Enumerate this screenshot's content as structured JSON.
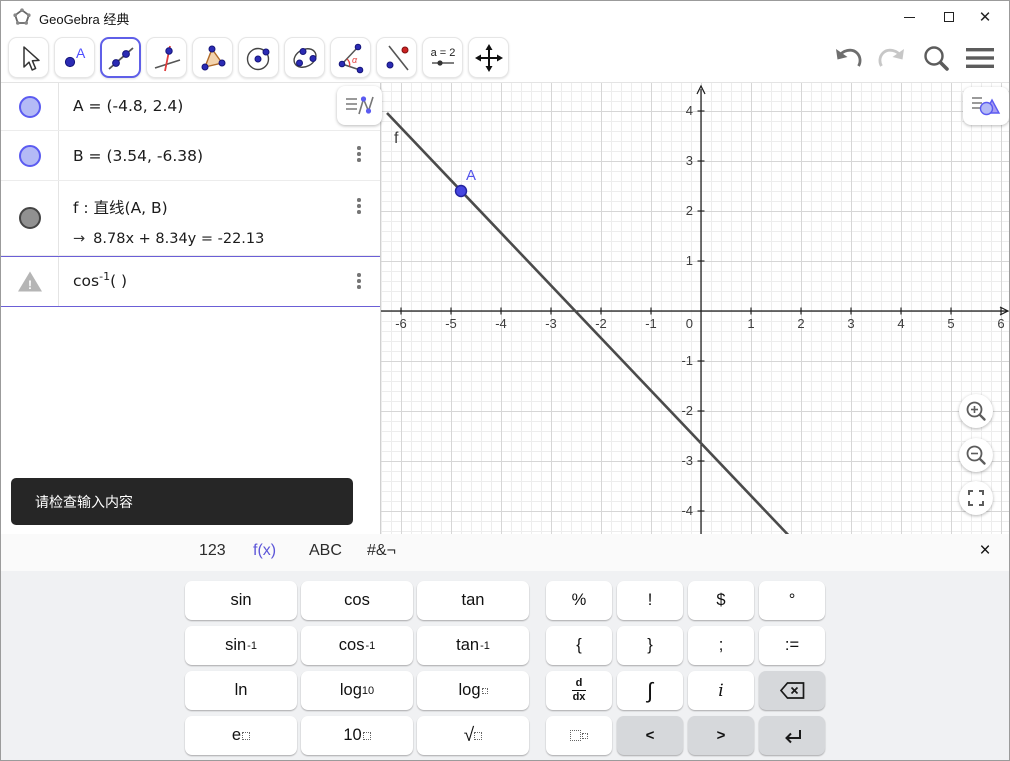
{
  "titlebar": {
    "title": "GeoGebra 经典"
  },
  "colors": {
    "accent": "#5b5bf1",
    "selected_tool_border": "#5f5fe8",
    "point": "#4646e0",
    "tooltip_bg": "#262626",
    "key_gray": "#d6d8db"
  },
  "toolbar": {
    "tools": [
      {
        "name": "move"
      },
      {
        "name": "point"
      },
      {
        "name": "line-through-two-points",
        "selected": true
      },
      {
        "name": "perpendicular-line"
      },
      {
        "name": "polygon"
      },
      {
        "name": "circle-with-center"
      },
      {
        "name": "conic-through-points"
      },
      {
        "name": "angle"
      },
      {
        "name": "reflect-about-line"
      },
      {
        "name": "slider"
      },
      {
        "name": "move-graphics-view"
      }
    ],
    "point_letter": "A",
    "angle_symbol": "α",
    "slider_label": "a = 2"
  },
  "algebra": {
    "rows": [
      {
        "id": "A",
        "text": "A = (-4.8, 2.4)"
      },
      {
        "id": "B",
        "text": "B = (3.54, -6.38)"
      },
      {
        "id": "f",
        "line1": "f : 直线(A, B)",
        "arrow": "→",
        "line2": "8.78x + 8.34y = -22.13"
      },
      {
        "id": "input",
        "base": "cos",
        "sup": "-1",
        "rest": "( )"
      }
    ]
  },
  "tooltip": {
    "text": "请检查输入内容"
  },
  "graphics": {
    "xneg": [
      "-6",
      "-5",
      "-4",
      "-3",
      "-2",
      "-1"
    ],
    "xpos": [
      "1",
      "2",
      "3",
      "4",
      "5",
      "6"
    ],
    "ypos": [
      "4",
      "3",
      "2",
      "1"
    ],
    "yneg": [
      "-1",
      "-2",
      "-3",
      "-4"
    ],
    "origin": "0",
    "point_label": "A",
    "line_label": "f"
  },
  "keyboard": {
    "tabs": [
      {
        "label": "123"
      },
      {
        "label": "f(x)",
        "selected": true
      },
      {
        "label": "ABC"
      },
      {
        "label": "#&¬"
      }
    ],
    "close": "×",
    "keys": {
      "sin": {
        "label": "sin"
      },
      "cos": {
        "label": "cos"
      },
      "tan": {
        "label": "tan"
      },
      "percent": {
        "label": "%"
      },
      "factorial": {
        "label": "!"
      },
      "dollar": {
        "label": "$"
      },
      "degree": {
        "label": "°"
      },
      "asin": {
        "base": "sin",
        "sup": "-1"
      },
      "acos": {
        "base": "cos",
        "sup": "-1"
      },
      "atan": {
        "base": "tan",
        "sup": "-1"
      },
      "brace_open": {
        "label": "{"
      },
      "brace_close": {
        "label": "}"
      },
      "semicolon": {
        "label": ";"
      },
      "assign": {
        "label": ":="
      },
      "ln": {
        "label": "ln"
      },
      "log10": {
        "base": "log",
        "sub": "10"
      },
      "logb": {
        "base": "log"
      },
      "ddx": {
        "num": "d",
        "den": "dx"
      },
      "integral": {
        "label": "∫"
      },
      "imaginary": {
        "label": "i"
      },
      "epow": {
        "base": "e"
      },
      "tenpow": {
        "base": "10"
      },
      "root": {
        "base": "√"
      },
      "left": {
        "label": "<"
      },
      "right": {
        "label": ">"
      }
    }
  }
}
